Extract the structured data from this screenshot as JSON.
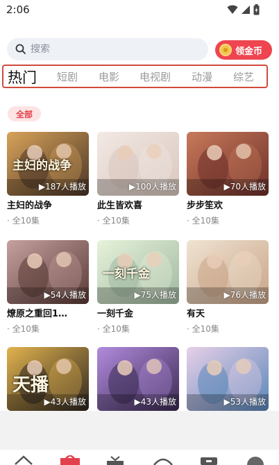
{
  "status": {
    "time": "2:06"
  },
  "search": {
    "placeholder": "搜索"
  },
  "coin_button": {
    "label": "领金币"
  },
  "tabs": [
    {
      "label": "热门",
      "active": true
    },
    {
      "label": "短剧",
      "active": false
    },
    {
      "label": "电影",
      "active": false
    },
    {
      "label": "电视剧",
      "active": false
    },
    {
      "label": "动漫",
      "active": false
    },
    {
      "label": "综艺",
      "active": false
    }
  ],
  "filter": {
    "label": "全部"
  },
  "cards": [
    {
      "title": "主妇的战争",
      "plays": "▶187人播放",
      "episodes": "· 全10集"
    },
    {
      "title": "此生皆欢喜",
      "plays": "▶100人播放",
      "episodes": "· 全10集"
    },
    {
      "title": "步步笙欢",
      "plays": "▶70人播放",
      "episodes": "· 全10集"
    },
    {
      "title": "燎原之重回1…",
      "plays": "▶54人播放",
      "episodes": "· 全10集"
    },
    {
      "title": "一刻千金",
      "plays": "▶75人播放",
      "episodes": "· 全10集"
    },
    {
      "title": "有天",
      "plays": "▶76人播放",
      "episodes": "· 全10集"
    },
    {
      "title": "",
      "plays": "▶43人播放",
      "episodes": ""
    },
    {
      "title": "",
      "plays": "▶43人播放",
      "episodes": ""
    },
    {
      "title": "",
      "plays": "▶53人播放",
      "episodes": ""
    }
  ],
  "thumb_colors": [
    "#4a3527",
    "#d9c7bd",
    "#6d2f2a",
    "#5a3a35",
    "#9fb8a0",
    "#c9a487",
    "#2d2622",
    "#3b2b52",
    "#5a86b8"
  ],
  "thumb_accents": [
    "#d8a35a",
    "#f2e8e4",
    "#c87a5a",
    "#c5a1a0",
    "#e7f2da",
    "#efe3d2",
    "#e2b34d",
    "#b18bdd",
    "#e7d0e8"
  ],
  "thumb_texts": [
    "主妇的战争",
    "",
    "",
    "",
    "一刻千金",
    "",
    "天播",
    "",
    ""
  ],
  "accent": "#e2404c"
}
